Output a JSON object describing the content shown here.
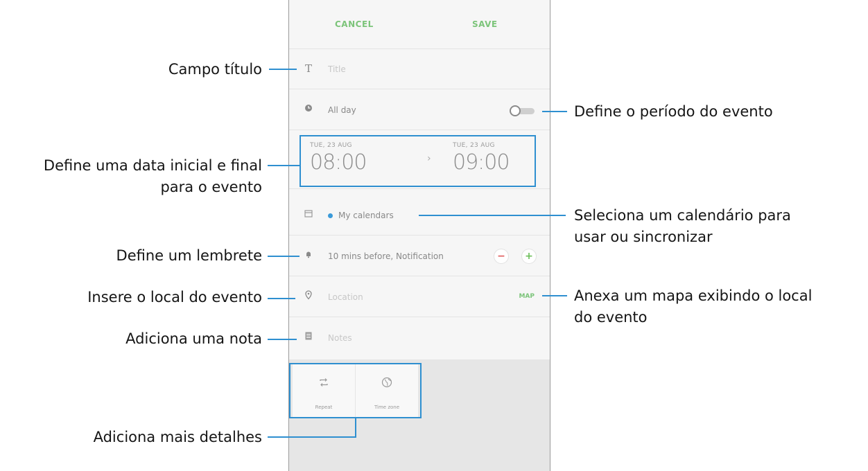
{
  "app": {
    "cancel_label": "CANCEL",
    "save_label": "SAVE",
    "title_placeholder": "Title",
    "all_day_label": "All day",
    "start_date": "TUE, 23 AUG",
    "start_time": "08:00",
    "end_date": "TUE, 23 AUG",
    "end_time": "09:00",
    "calendar_label": "My calendars",
    "calendar_dot_color": "#3a9ad9",
    "reminder_label": "10 mins before, Notification",
    "location_placeholder": "Location",
    "map_label": "MAP",
    "notes_placeholder": "Notes",
    "repeat_label": "Repeat",
    "timezone_label": "Time zone",
    "accent_color": "#7cc47a"
  },
  "callouts": {
    "title_field": "Campo título",
    "period": "Define o período do evento",
    "dates_line1": "Define uma data inicial e final",
    "dates_line2": "para o evento",
    "calendar_line1": "Seleciona um calendário para",
    "calendar_line2": "usar ou sincronizar",
    "reminder": "Define um lembrete",
    "location": "Insere o local do evento",
    "map_line1": "Anexa um mapa exibindo o local",
    "map_line2": "do evento",
    "note": "Adiciona uma nota",
    "details": "Adiciona mais detalhes",
    "line_color": "#2e8fd0"
  }
}
